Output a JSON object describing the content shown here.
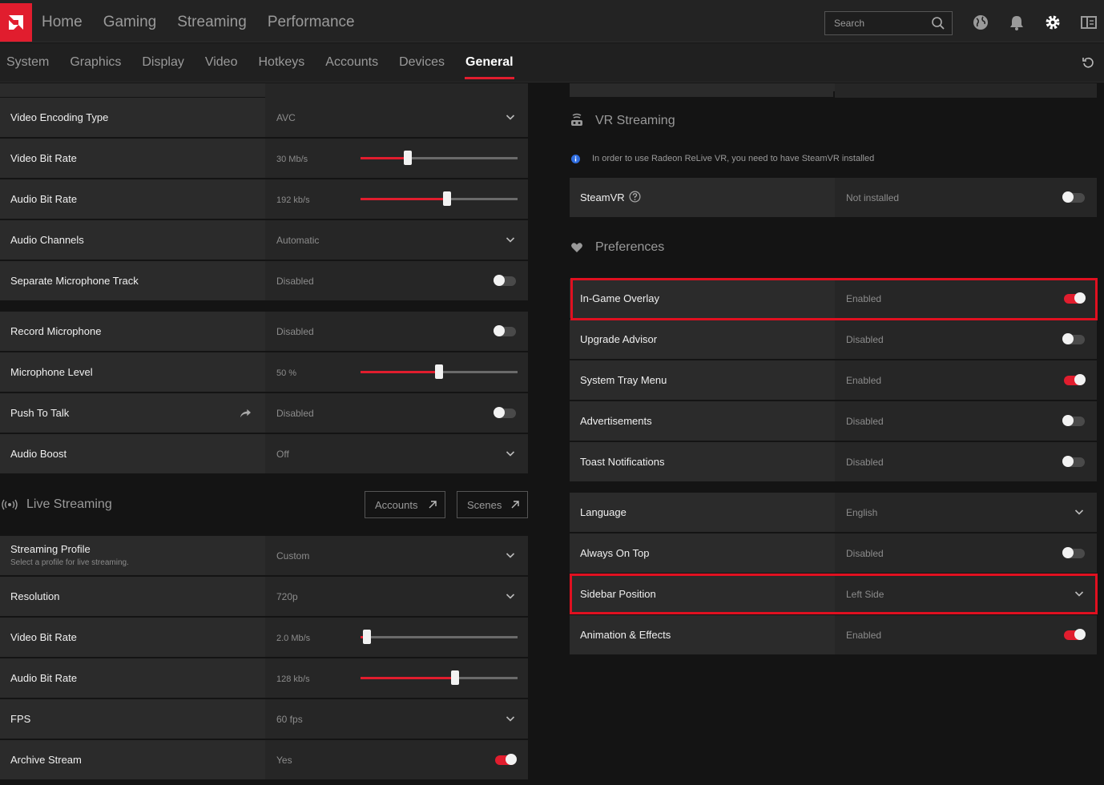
{
  "nav": {
    "items": [
      "Home",
      "Gaming",
      "Streaming",
      "Performance"
    ],
    "search_placeholder": "Search"
  },
  "subnav": {
    "tabs": [
      "System",
      "Graphics",
      "Display",
      "Video",
      "Hotkeys",
      "Accounts",
      "Devices",
      "General"
    ],
    "active": "General"
  },
  "left": {
    "recording_rows": [
      {
        "label": "Video Encoding Type",
        "value": "AVC",
        "control": "dropdown"
      },
      {
        "label": "Video Bit Rate",
        "value": "30 Mb/s",
        "control": "slider",
        "level": 0.3
      },
      {
        "label": "Audio Bit Rate",
        "value": "192 kb/s",
        "control": "slider",
        "level": 0.55
      },
      {
        "label": "Audio Channels",
        "value": "Automatic",
        "control": "dropdown"
      },
      {
        "label": "Separate Microphone Track",
        "value": "Disabled",
        "control": "toggle",
        "on": false
      }
    ],
    "mic_rows": [
      {
        "label": "Record Microphone",
        "value": "Disabled",
        "control": "toggle",
        "on": false
      },
      {
        "label": "Microphone Level",
        "value": "50 %",
        "control": "slider",
        "level": 0.5
      },
      {
        "label": "Push To Talk",
        "value": "Disabled",
        "control": "toggle",
        "on": false
      },
      {
        "label": "Audio Boost",
        "value": "Off",
        "control": "dropdown"
      }
    ],
    "live_streaming": {
      "title": "Live Streaming",
      "accounts_button": "Accounts",
      "scenes_button": "Scenes"
    },
    "streaming_rows": [
      {
        "label": "Streaming Profile",
        "sublabel": "Select a profile for live streaming.",
        "value": "Custom",
        "control": "dropdown"
      },
      {
        "label": "Resolution",
        "value": "720p",
        "control": "dropdown"
      },
      {
        "label": "Video Bit Rate",
        "value": "2.0 Mb/s",
        "control": "slider",
        "level": 0.04
      },
      {
        "label": "Audio Bit Rate",
        "value": "128 kb/s",
        "control": "slider",
        "level": 0.6
      },
      {
        "label": "FPS",
        "value": "60 fps",
        "control": "dropdown"
      },
      {
        "label": "Archive Stream",
        "value": "Yes",
        "control": "toggle",
        "on": true
      }
    ]
  },
  "right": {
    "vr": {
      "title": "VR Streaming",
      "info": "In order to use Radeon ReLive VR, you need to have SteamVR installed",
      "row": {
        "label": "SteamVR",
        "value": "Not installed",
        "control": "toggle",
        "on": false
      }
    },
    "preferences": {
      "title": "Preferences",
      "rows1": [
        {
          "label": "In-Game Overlay",
          "value": "Enabled",
          "control": "toggle",
          "on": true
        },
        {
          "label": "Upgrade Advisor",
          "value": "Disabled",
          "control": "toggle",
          "on": false
        },
        {
          "label": "System Tray Menu",
          "value": "Enabled",
          "control": "toggle",
          "on": true
        },
        {
          "label": "Advertisements",
          "value": "Disabled",
          "control": "toggle",
          "on": false
        },
        {
          "label": "Toast Notifications",
          "value": "Disabled",
          "control": "toggle",
          "on": false
        }
      ],
      "rows2": [
        {
          "label": "Language",
          "value": "English",
          "control": "dropdown"
        },
        {
          "label": "Always On Top",
          "value": "Disabled",
          "control": "toggle",
          "on": false
        },
        {
          "label": "Sidebar Position",
          "value": "Left Side",
          "control": "dropdown"
        },
        {
          "label": "Animation & Effects",
          "value": "Enabled",
          "control": "toggle",
          "on": true
        }
      ]
    }
  },
  "colors": {
    "accent": "#e11d2e",
    "highlight": "#e01020",
    "row_label_bg": "#2b2b2b",
    "row_value_bg": "#262626"
  }
}
